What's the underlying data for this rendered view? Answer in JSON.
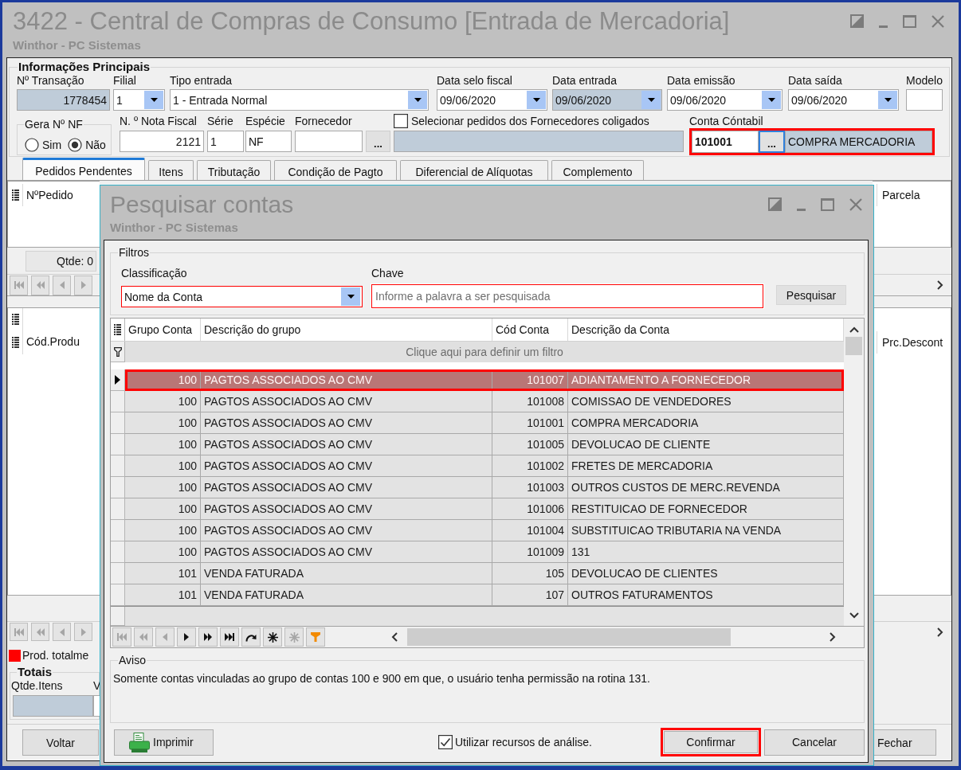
{
  "window": {
    "title": "3422 - Central de Compras de Consumo [Entrada de Mercadoria]",
    "subtitle": "Winthor - PC Sistemas"
  },
  "main": {
    "section_title": "Informações Principais",
    "fields_row_1": [
      {
        "label": "Nº Transação",
        "value": "1778454",
        "kind": "number",
        "readonly": true
      },
      {
        "label": "Filial",
        "value": "1",
        "kind": "combo",
        "readonly": false
      },
      {
        "label": "Tipo entrada",
        "value": "1 - Entrada Normal",
        "kind": "combo",
        "readonly": false
      },
      {
        "label": "Data selo fiscal",
        "value": "09/06/2020",
        "kind": "combo",
        "readonly": false
      },
      {
        "label": "Data entrada",
        "value": "09/06/2020",
        "kind": "combo",
        "readonly": true
      },
      {
        "label": "Data emissão",
        "value": "09/06/2020",
        "kind": "combo",
        "readonly": false
      },
      {
        "label": "Data saída",
        "value": "09/06/2020",
        "kind": "combo",
        "readonly": false
      },
      {
        "label": "Modelo",
        "kind": "text",
        "readonly": false
      }
    ],
    "gera_nf": {
      "title": "Gera Nº NF",
      "options": [
        {
          "label": "Sim",
          "selected": false
        },
        {
          "label": "Não",
          "selected": true
        }
      ]
    },
    "fields_row_2": [
      {
        "label": "N. º Nota Fiscal",
        "value": "2121",
        "kind": "number"
      },
      {
        "label": "Série",
        "value": "1",
        "kind": "text"
      },
      {
        "label": "Espécie",
        "value": "NF",
        "kind": "text"
      },
      {
        "label": "Fornecedor",
        "kind": "lookup",
        "button": "..."
      }
    ],
    "coligados": {
      "label": "Selecionar pedidos dos Fornecedores coligados",
      "checked": false
    },
    "account": {
      "label": "Conta Cóntabil",
      "code": "101001",
      "button": "...",
      "description": "COMPRA MERCADORIA",
      "highlighted": true
    },
    "tabs": [
      {
        "label": "Pedidos Pendentes",
        "selected": true
      },
      {
        "label": "Itens",
        "selected": false
      },
      {
        "label": "Tributação",
        "selected": false
      },
      {
        "label": "Condição de Pagto",
        "selected": false
      },
      {
        "label": "Diferencial de Alíquotas",
        "selected": false
      },
      {
        "label": "Complemento",
        "selected": false
      }
    ],
    "orders_grid": {
      "column_1": "NºPedido",
      "column_right": "Parcela",
      "count": "Qtde: 0",
      "navigator": [
        {
          "kind": "first",
          "disabled": true
        },
        {
          "kind": "prior_page",
          "disabled": true
        },
        {
          "kind": "prior",
          "disabled": true
        },
        {
          "kind": "next",
          "disabled": true
        }
      ]
    },
    "items_grid": {
      "column_1": "Cód.Produ",
      "column_right": "Prc.Descont",
      "navigator": [
        {
          "kind": "first",
          "disabled": true
        },
        {
          "kind": "prior_page",
          "disabled": true
        },
        {
          "kind": "prior",
          "disabled": true
        },
        {
          "kind": "next",
          "disabled": true
        }
      ]
    },
    "legend": {
      "label": "Prod. totalme"
    },
    "totals": {
      "title": "Totais",
      "labels": [
        "Qtde.Itens",
        "V"
      ]
    },
    "buttons": [
      "Voltar",
      "Fechar"
    ]
  },
  "dialog": {
    "title": "Pesquisar contas",
    "subtitle": "Winthor - PC Sistemas",
    "filters": {
      "title": "Filtros",
      "classification": {
        "label": "Classificação",
        "value": "Nome da Conta",
        "highlighted": true
      },
      "key": {
        "label": "Chave",
        "placeholder": "Informe a palavra a ser pesquisada",
        "highlighted": true
      },
      "search_button": "Pesquisar"
    },
    "table": {
      "columns": [
        "Grupo Conta",
        "Descrição do grupo",
        "Cód Conta",
        "Descrição da Conta"
      ],
      "filter_hint": "Clique aqui para definir um filtro",
      "rows": [
        {
          "cells": [
            "100",
            "PAGTOS ASSOCIADOS AO CMV",
            "101007",
            "ADIANTAMENTO A FORNECEDOR"
          ],
          "selected": true,
          "highlighted": true
        },
        {
          "cells": [
            "100",
            "PAGTOS ASSOCIADOS AO CMV",
            "101008",
            "COMISSAO DE VENDEDORES"
          ],
          "selected": false,
          "highlighted": false
        },
        {
          "cells": [
            "100",
            "PAGTOS ASSOCIADOS AO CMV",
            "101001",
            "COMPRA MERCADORIA"
          ],
          "selected": false,
          "highlighted": false
        },
        {
          "cells": [
            "100",
            "PAGTOS ASSOCIADOS AO CMV",
            "101005",
            "DEVOLUCAO DE CLIENTE"
          ],
          "selected": false,
          "highlighted": false
        },
        {
          "cells": [
            "100",
            "PAGTOS ASSOCIADOS AO CMV",
            "101002",
            "FRETES DE MERCADORIA"
          ],
          "selected": false,
          "highlighted": false
        },
        {
          "cells": [
            "100",
            "PAGTOS ASSOCIADOS AO CMV",
            "101003",
            "OUTROS CUSTOS DE MERC.REVENDA"
          ],
          "selected": false,
          "highlighted": false
        },
        {
          "cells": [
            "100",
            "PAGTOS ASSOCIADOS AO CMV",
            "101006",
            "RESTITUICAO DE FORNECEDOR"
          ],
          "selected": false,
          "highlighted": false
        },
        {
          "cells": [
            "100",
            "PAGTOS ASSOCIADOS AO CMV",
            "101004",
            "SUBSTITUICAO TRIBUTARIA NA VENDA"
          ],
          "selected": false,
          "highlighted": false
        },
        {
          "cells": [
            "100",
            "PAGTOS ASSOCIADOS AO CMV",
            "101009",
            "131"
          ],
          "selected": false,
          "highlighted": false
        },
        {
          "cells": [
            "101",
            "VENDA FATURADA",
            "105",
            "DEVOLUCAO DE CLIENTES"
          ],
          "selected": false,
          "highlighted": false
        },
        {
          "cells": [
            "101",
            "VENDA FATURADA",
            "107",
            "OUTROS FATURAMENTOS"
          ],
          "selected": false,
          "highlighted": false
        }
      ]
    },
    "navigator": [
      {
        "kind": "first",
        "disabled": true
      },
      {
        "kind": "prior_page",
        "disabled": true
      },
      {
        "kind": "prior",
        "disabled": true
      },
      {
        "kind": "next",
        "disabled": false
      },
      {
        "kind": "next_page",
        "disabled": false
      },
      {
        "kind": "last",
        "disabled": false
      },
      {
        "kind": "refresh",
        "disabled": false
      },
      {
        "kind": "insert",
        "disabled": false
      },
      {
        "kind": "cancel",
        "disabled": true
      },
      {
        "kind": "filter",
        "disabled": false
      }
    ],
    "notice": {
      "title": "Aviso",
      "text": "Somente contas vinculadas ao grupo de contas 100 e 900 em que, o usuário tenha permissão na rotina 131."
    },
    "print_button": "Imprimir",
    "analysis": {
      "label": "Utilizar recursos de análise.",
      "checked": true
    },
    "buttons": [
      {
        "label": "Confirmar",
        "highlighted": true
      },
      {
        "label": "Cancelar",
        "highlighted": false
      }
    ]
  }
}
